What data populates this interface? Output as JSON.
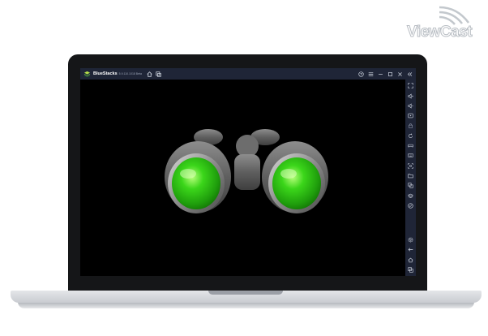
{
  "watermark": {
    "text": "ViewCast"
  },
  "window": {
    "app_name": "BlueStacks",
    "version": "5.9.110.1018 Beta"
  },
  "titlebar_icons": [
    "home-icon",
    "multi-instance-icon",
    "help-icon",
    "menu-icon",
    "minimize-icon",
    "maximize-icon",
    "close-icon",
    "collapse-icon"
  ],
  "sidebar_icons": [
    "fullscreen-icon",
    "volume-up-icon",
    "volume-down-icon",
    "screen-record-icon",
    "lock-icon",
    "rotate-icon",
    "gamepad-icon",
    "keyboard-icon",
    "screenshot-icon",
    "folder-icon",
    "copy-icon",
    "layers-icon",
    "eco-icon",
    "settings-icon",
    "back-icon",
    "home-icon",
    "recent-apps-icon"
  ],
  "colors": {
    "titlebar": "#1f2537",
    "screen": "#000000",
    "lens_green": "#3bd61a",
    "logo_green": "#6cc04a"
  },
  "app_content": {
    "image": "binoculars-logo"
  }
}
